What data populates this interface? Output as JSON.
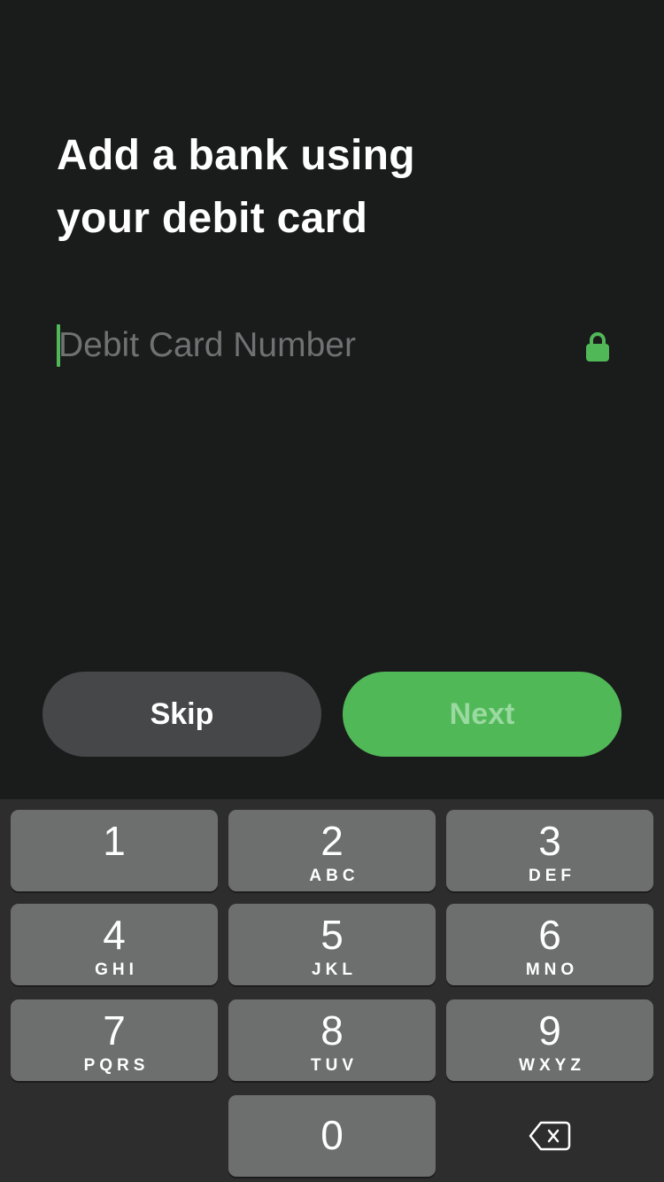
{
  "header": {
    "title_lines": [
      "Add a bank using",
      "your debit card"
    ]
  },
  "card_field": {
    "placeholder": "Debit Card Number",
    "value": "",
    "icon": "lock-icon"
  },
  "actions": {
    "skip_label": "Skip",
    "next_label": "Next"
  },
  "colors": {
    "accent": "#51b858",
    "background": "#1a1b1b",
    "secondary_button": "#464749",
    "keypad_bg": "#2d2d2d",
    "key_bg": "#6d6f6e"
  },
  "keypad": {
    "keys": [
      {
        "digit": "1",
        "letters": ""
      },
      {
        "digit": "2",
        "letters": "ABC"
      },
      {
        "digit": "3",
        "letters": "DEF"
      },
      {
        "digit": "4",
        "letters": "GHI"
      },
      {
        "digit": "5",
        "letters": "JKL"
      },
      {
        "digit": "6",
        "letters": "MNO"
      },
      {
        "digit": "7",
        "letters": "PQRS"
      },
      {
        "digit": "8",
        "letters": "TUV"
      },
      {
        "digit": "9",
        "letters": "WXYZ"
      },
      {
        "digit": "0",
        "letters": ""
      }
    ],
    "delete_icon": "backspace-icon"
  }
}
